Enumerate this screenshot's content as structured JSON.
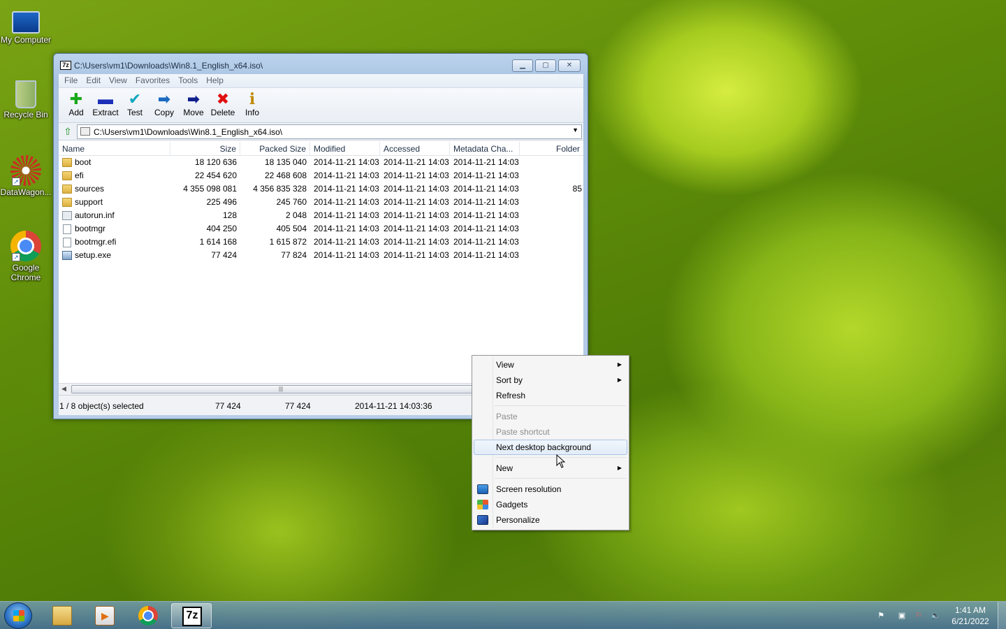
{
  "desktop": {
    "icons": [
      {
        "label": "My Computer",
        "icon": "computer-icon"
      },
      {
        "label": "Recycle Bin",
        "icon": "recycle-bin-icon"
      },
      {
        "label": "DataWagon...",
        "icon": "datawagon-icon"
      },
      {
        "label": "Google Chrome",
        "icon": "chrome-icon"
      }
    ]
  },
  "window": {
    "title": "C:\\Users\\vm1\\Downloads\\Win8.1_English_x64.iso\\",
    "app_icon": "7z",
    "menu": [
      "File",
      "Edit",
      "View",
      "Favorites",
      "Tools",
      "Help"
    ],
    "toolbar": [
      {
        "label": "Add",
        "icon": "add-icon",
        "glyph": "✚"
      },
      {
        "label": "Extract",
        "icon": "extract-icon",
        "glyph": "▬"
      },
      {
        "label": "Test",
        "icon": "test-icon",
        "glyph": "✔"
      },
      {
        "label": "Copy",
        "icon": "copy-icon",
        "glyph": "➡"
      },
      {
        "label": "Move",
        "icon": "move-icon",
        "glyph": "➡"
      },
      {
        "label": "Delete",
        "icon": "delete-icon",
        "glyph": "✖"
      },
      {
        "label": "Info",
        "icon": "info-icon",
        "glyph": "i"
      }
    ],
    "address": "C:\\Users\\vm1\\Downloads\\Win8.1_English_x64.iso\\",
    "columns": [
      "Name",
      "Size",
      "Packed Size",
      "Modified",
      "Accessed",
      "Metadata Cha...",
      "Folder"
    ],
    "rows": [
      {
        "type": "folder",
        "name": "boot",
        "size": "18 120 636",
        "packed": "18 135 040",
        "modified": "2014-11-21 14:03",
        "accessed": "2014-11-21 14:03",
        "meta": "2014-11-21 14:03",
        "folder": ""
      },
      {
        "type": "folder",
        "name": "efi",
        "size": "22 454 620",
        "packed": "22 468 608",
        "modified": "2014-11-21 14:03",
        "accessed": "2014-11-21 14:03",
        "meta": "2014-11-21 14:03",
        "folder": ""
      },
      {
        "type": "folder",
        "name": "sources",
        "size": "4 355 098 081",
        "packed": "4 356 835 328",
        "modified": "2014-11-21 14:03",
        "accessed": "2014-11-21 14:03",
        "meta": "2014-11-21 14:03",
        "folder": "85"
      },
      {
        "type": "folder",
        "name": "support",
        "size": "225 496",
        "packed": "245 760",
        "modified": "2014-11-21 14:03",
        "accessed": "2014-11-21 14:03",
        "meta": "2014-11-21 14:03",
        "folder": ""
      },
      {
        "type": "inf",
        "name": "autorun.inf",
        "size": "128",
        "packed": "2 048",
        "modified": "2014-11-21 14:03",
        "accessed": "2014-11-21 14:03",
        "meta": "2014-11-21 14:03",
        "folder": ""
      },
      {
        "type": "file",
        "name": "bootmgr",
        "size": "404 250",
        "packed": "405 504",
        "modified": "2014-11-21 14:03",
        "accessed": "2014-11-21 14:03",
        "meta": "2014-11-21 14:03",
        "folder": ""
      },
      {
        "type": "file",
        "name": "bootmgr.efi",
        "size": "1 614 168",
        "packed": "1 615 872",
        "modified": "2014-11-21 14:03",
        "accessed": "2014-11-21 14:03",
        "meta": "2014-11-21 14:03",
        "folder": ""
      },
      {
        "type": "exe",
        "name": "setup.exe",
        "size": "77 424",
        "packed": "77 824",
        "modified": "2014-11-21 14:03",
        "accessed": "2014-11-21 14:03",
        "meta": "2014-11-21 14:03",
        "folder": ""
      }
    ],
    "status": {
      "selection": "1 / 8 object(s) selected",
      "size": "77 424",
      "packed": "77 424",
      "date": "2014-11-21 14:03:36"
    }
  },
  "context_menu": {
    "items": [
      {
        "label": "View",
        "submenu": true,
        "disabled": false
      },
      {
        "label": "Sort by",
        "submenu": true,
        "disabled": false
      },
      {
        "label": "Refresh",
        "submenu": false,
        "disabled": false
      },
      {
        "separator": true
      },
      {
        "label": "Paste",
        "submenu": false,
        "disabled": true
      },
      {
        "label": "Paste shortcut",
        "submenu": false,
        "disabled": true
      },
      {
        "label": "Next desktop background",
        "submenu": false,
        "disabled": false,
        "hover": true
      },
      {
        "separator": true
      },
      {
        "label": "New",
        "submenu": true,
        "disabled": false
      },
      {
        "separator": true
      },
      {
        "label": "Screen resolution",
        "submenu": false,
        "disabled": false,
        "icon": "screen-resolution-icon"
      },
      {
        "label": "Gadgets",
        "submenu": false,
        "disabled": false,
        "icon": "gadgets-icon"
      },
      {
        "label": "Personalize",
        "submenu": false,
        "disabled": false,
        "icon": "personalize-icon"
      }
    ]
  },
  "taskbar": {
    "pinned": [
      "windows-explorer-icon",
      "media-player-icon",
      "chrome-icon",
      "7zip-icon"
    ],
    "active": "7zip-icon",
    "app_7z_label": "7z",
    "clock_time": "1:41 AM",
    "clock_date": "6/21/2022"
  }
}
